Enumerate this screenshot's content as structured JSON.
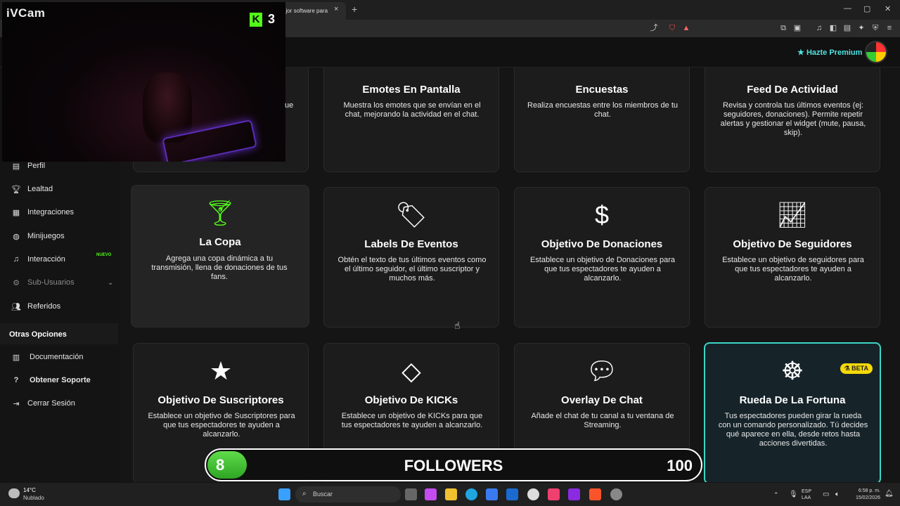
{
  "webcam": {
    "title": "iVCam",
    "kick_count": "3",
    "kick_logo": "K"
  },
  "browser": {
    "tab_title": "ejor software para",
    "tab_close": "×",
    "new_tab": "+",
    "window_controls": [
      "—",
      "▢",
      "✕"
    ]
  },
  "header": {
    "premium_label": "Hazte Premium"
  },
  "sidebar": {
    "items": [
      {
        "label": "Perfil",
        "icon": "id-card-icon"
      },
      {
        "label": "Lealtad",
        "icon": "trophy-icon"
      },
      {
        "label": "Integraciones",
        "icon": "plug-icon"
      },
      {
        "label": "Minijuegos",
        "icon": "gamepad-icon"
      },
      {
        "label": "Interacción",
        "icon": "music-icon",
        "badge": "NUEVO"
      },
      {
        "label": "Sub-Usuarios",
        "icon": "users-cog-icon"
      },
      {
        "label": "Referidos",
        "icon": "users-icon"
      }
    ],
    "section_title": "Otras Opciones",
    "other_items": [
      {
        "label": "Documentación",
        "icon": "book-icon"
      },
      {
        "label": "Obtener Soporte",
        "icon": "question-icon"
      },
      {
        "label": "Cerrar Sesión",
        "icon": "sign-out-icon"
      }
    ],
    "partial_text": "ue"
  },
  "cards": [
    {
      "title": "Emotes En Pantalla",
      "desc": "Muestra los emotes que se envían en el chat, mejorando la actividad en el chat."
    },
    {
      "title": "Encuestas",
      "desc": "Realiza encuestas entre los miembros de tu chat."
    },
    {
      "title": "Feed De Actividad",
      "desc": "Revisa y controla tus últimos eventos (ej: seguidores, donaciones). Permite repetir alertas y gestionar el widget (mute, pausa, skip)."
    },
    {
      "title": "La Copa",
      "desc": "Agrega una copa dinámica a tu transmisión, llena de donaciones de tus fans.",
      "icon": "cocktail-icon"
    },
    {
      "title": "Labels De Eventos",
      "desc": "Obtén el texto de tus últimos eventos como el último seguidor, el último suscriptor y muchos más.",
      "icon": "tags-icon"
    },
    {
      "title": "Objetivo De Donaciones",
      "desc": "Establece un objetivo de Donaciones para que tus espectadores te ayuden a alcanzarlo.",
      "icon": "dollar-icon"
    },
    {
      "title": "Objetivo De Seguidores",
      "desc": "Establece un objetivo de seguidores para que tus espectadores te ayuden a alcanzarlo.",
      "icon": "chart-line-icon"
    },
    {
      "title": "Objetivo De Suscriptores",
      "desc": "Establece un objetivo de Suscriptores para que tus espectadores te ayuden a alcanzarlo.",
      "icon": "star-icon"
    },
    {
      "title": "Objetivo De KICKs",
      "desc": "Establece un objetivo de KICKs para que tus espectadores te ayuden a alcanzarlo.",
      "icon": "gem-icon"
    },
    {
      "title": "Overlay De Chat",
      "desc": "Añade el chat de tu canal a tu ventana de Streaming.",
      "icon": "comment-icon"
    },
    {
      "title": "Rueda De La Fortuna",
      "desc": "Tus espectadores pueden girar la rueda con un comando personalizado. Tú decides qué aparece en ella, desde retos hasta acciones divertidas.",
      "icon": "dharmachakra-icon",
      "badge": "BETA"
    }
  ],
  "followers_goal": {
    "label": "FOLLOWERS",
    "current": "8",
    "goal": "100",
    "progress": 0.08,
    "fill_color": "#4cc83a"
  },
  "taskbar": {
    "weather_temp": "14°C",
    "weather_desc": "Nublado",
    "search_placeholder": "Buscar",
    "lang_top": "ESP",
    "lang_bottom": "LAA",
    "time": "6:58 p. m.",
    "date": "15/02/2026"
  },
  "colors": {
    "accent": "#53fc18",
    "premium": "#4fe3e0",
    "beta_border": "#3bd6c6",
    "beta_badge": "#f5d90a"
  }
}
